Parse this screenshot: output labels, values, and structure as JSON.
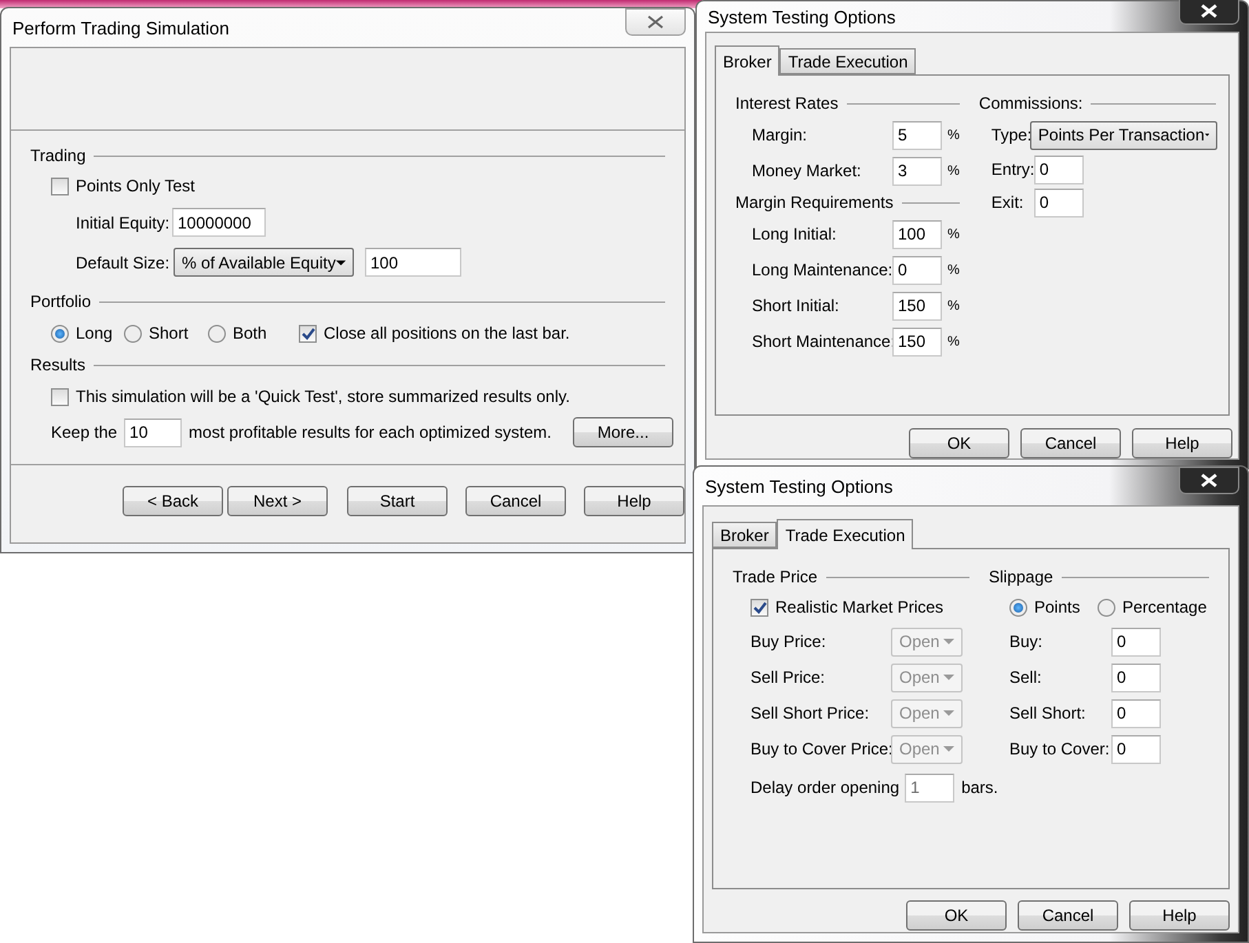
{
  "simulation_dialog": {
    "title": "Perform Trading Simulation",
    "trading": {
      "heading": "Trading",
      "points_only": {
        "label": "Points Only Test",
        "checked": false
      },
      "initial_equity": {
        "label": "Initial Equity:",
        "value": "10000000"
      },
      "default_size": {
        "label": "Default Size:",
        "option": "% of Available Equity",
        "value": "100"
      }
    },
    "portfolio": {
      "heading": "Portfolio",
      "options": [
        {
          "label": "Long",
          "selected": true
        },
        {
          "label": "Short",
          "selected": false
        },
        {
          "label": "Both",
          "selected": false
        }
      ],
      "close_all": {
        "label": "Close all positions on the last bar.",
        "checked": true
      }
    },
    "results": {
      "heading": "Results",
      "quick_test": {
        "label": "This simulation will be a 'Quick Test', store summarized results only.",
        "checked": false
      },
      "keep_prefix": "Keep the",
      "keep_value": "10",
      "keep_suffix": "most profitable results for each optimized system.",
      "more_button": "More..."
    },
    "buttons": [
      "< Back",
      "Next >",
      "Start",
      "Cancel",
      "Help"
    ]
  },
  "broker_dialog": {
    "title": "System Testing Options",
    "tabs": [
      {
        "label": "Broker",
        "selected": true
      },
      {
        "label": "Trade Execution",
        "selected": false
      }
    ],
    "groups": [
      {
        "heading": "Interest Rates",
        "rows": [
          {
            "label": "Margin:",
            "value": "5",
            "unit": "%"
          },
          {
            "label": "Money Market:",
            "value": "3",
            "unit": "%"
          }
        ]
      },
      {
        "heading": "Margin Requirements",
        "rows": [
          {
            "label": "Long Initial:",
            "value": "100",
            "unit": "%"
          },
          {
            "label": "Long Maintenance:",
            "value": "0",
            "unit": "%"
          },
          {
            "label": "Short Initial:",
            "value": "150",
            "unit": "%"
          },
          {
            "label": "Short Maintenance:",
            "value": "150",
            "unit": "%"
          }
        ]
      }
    ],
    "commissions": {
      "heading": "Commissions:",
      "type_label": "Type:",
      "type_value": "Points Per Transaction",
      "rows": [
        {
          "label": "Entry:",
          "value": "0"
        },
        {
          "label": "Exit:",
          "value": "0"
        }
      ]
    },
    "buttons": [
      "OK",
      "Cancel",
      "Help"
    ]
  },
  "execution_dialog": {
    "title": "System Testing Options",
    "tabs": [
      {
        "label": "Broker",
        "selected": false
      },
      {
        "label": "Trade Execution",
        "selected": true
      }
    ],
    "trade_price": {
      "heading": "Trade Price",
      "realistic": {
        "label": "Realistic Market Prices",
        "checked": true
      },
      "rows": [
        {
          "label": "Buy Price:",
          "value": "Open",
          "disabled": true
        },
        {
          "label": "Sell Price:",
          "value": "Open",
          "disabled": true
        },
        {
          "label": "Sell Short Price:",
          "value": "Open",
          "disabled": true
        },
        {
          "label": "Buy to Cover Price:",
          "value": "Open",
          "disabled": true
        }
      ],
      "delay": {
        "label": "Delay order opening",
        "value": "1",
        "unit": "bars.",
        "disabled": true
      }
    },
    "slippage": {
      "heading": "Slippage",
      "options": [
        {
          "label": "Points",
          "selected": true
        },
        {
          "label": "Percentage",
          "selected": false
        }
      ],
      "rows": [
        {
          "label": "Buy:",
          "value": "0"
        },
        {
          "label": "Sell:",
          "value": "0"
        },
        {
          "label": "Sell Short:",
          "value": "0"
        },
        {
          "label": "Buy to Cover:",
          "value": "0"
        }
      ]
    },
    "buttons": [
      "OK",
      "Cancel",
      "Help"
    ]
  }
}
